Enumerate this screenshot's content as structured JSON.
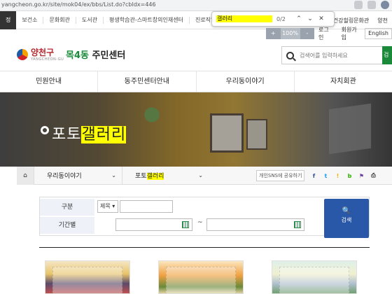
{
  "browser": {
    "url": "yangcheon.go.kr/site/mok04/ex/bbs/List.do?cbIdx=446"
  },
  "strip": {
    "links": [
      "정",
      "보건소",
      "문화회관",
      "도서관",
      "평생학습관-스마트창의인재센터",
      "진로직업체험지"
    ],
    "right_links": [
      "건강힐링문화관",
      "양천"
    ]
  },
  "find": {
    "query": "갤러리",
    "count": "0/2",
    "up": "⌃",
    "down": "⌄",
    "close": "✕"
  },
  "util": {
    "zoom_in": "+",
    "zoom_value": "100%",
    "zoom_out": "-",
    "login": "로그인",
    "join": "회원가입",
    "lang": "English"
  },
  "header": {
    "logo_text": "양천구",
    "logo_sub": "YANGCHEON-GU",
    "site_name_hl": "목4동",
    "site_name_rest": " 주민센터",
    "search_placeholder": "검색어를 입력하세요",
    "search_button": "검"
  },
  "gnb": [
    "민원안내",
    "동주민센터안내",
    "우리동이야기",
    "자치회관"
  ],
  "banner": {
    "title_pre": "포토",
    "title_hl": "갤러리"
  },
  "location": {
    "home": "⌂",
    "menu1": "우리동이야기",
    "menu2_pre": "포토",
    "menu2_hl": "갤러리",
    "share_label": "개인SNS에 공유하기",
    "sns": [
      "f",
      "t",
      "!",
      "b",
      "⚑",
      "⎙"
    ],
    "sns_colors": [
      "#3b5998",
      "#1da1f2",
      "#f0b400",
      "#2db400",
      "#6a3fa0",
      "#333333"
    ]
  },
  "form": {
    "label_category": "구분",
    "select_value": "제목 ▾",
    "label_period": "기간별",
    "tilde": "~",
    "submit_icon": "🔍",
    "submit_label": "검색"
  }
}
